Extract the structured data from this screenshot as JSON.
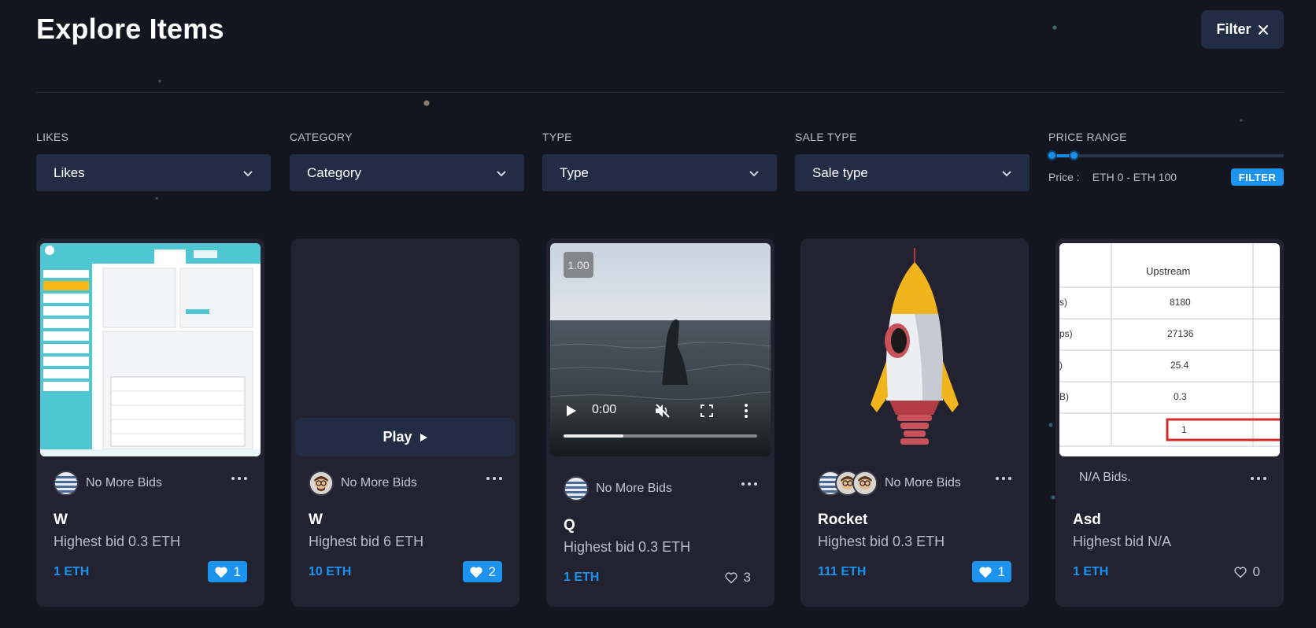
{
  "header": {
    "title": "Explore Items",
    "filter_button_label": "Filter"
  },
  "filters": {
    "likes": {
      "label": "LIKES",
      "value": "Likes"
    },
    "category": {
      "label": "CATEGORY",
      "value": "Category"
    },
    "type": {
      "label": "TYPE",
      "value": "Type"
    },
    "sale_type": {
      "label": "SALE TYPE",
      "value": "Sale type"
    },
    "price_range": {
      "label": "PRICE RANGE",
      "price_label": "Price :",
      "range_text": "ETH 0 - ETH 100",
      "button_label": "FILTER",
      "accent": "#1c93ee"
    }
  },
  "cards": [
    {
      "bids": "No More Bids",
      "name": "W",
      "highest_bid": "Highest bid 0.3 ETH",
      "price": "1 ETH",
      "likes": "1",
      "liked": true
    },
    {
      "bids": "No More Bids",
      "name": "W",
      "highest_bid": "Highest bid 6 ETH",
      "price": "10 ETH",
      "likes": "2",
      "liked": true,
      "play_label": "Play"
    },
    {
      "bids": "No More Bids",
      "name": "Q",
      "highest_bid": "Highest bid 0.3 ETH",
      "price": "1 ETH",
      "likes": "3",
      "liked": false,
      "video": {
        "speed": "1.00",
        "time": "0:00",
        "progress": 0.31
      }
    },
    {
      "bids": "No More Bids",
      "name": "Rocket",
      "highest_bid": "Highest bid 0.3 ETH",
      "price": "111 ETH",
      "likes": "1",
      "liked": true
    },
    {
      "bids": "N/A Bids.",
      "name": "Asd",
      "highest_bid": "Highest bid N/A",
      "price": "1 ETH",
      "likes": "0",
      "liked": false,
      "table": {
        "header": "Upstream",
        "rows": [
          [
            "s)",
            "8180"
          ],
          [
            "ps)",
            "27136"
          ],
          [
            ")",
            "25.4"
          ],
          [
            "B)",
            "0.3"
          ],
          [
            "",
            "1"
          ]
        ]
      }
    }
  ]
}
